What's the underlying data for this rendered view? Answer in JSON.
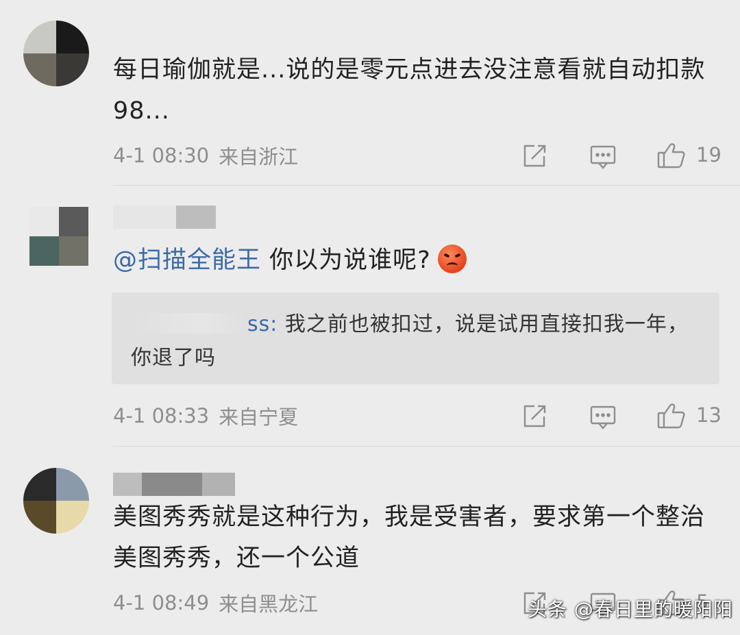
{
  "comments": [
    {
      "text": "每日瑜伽就是...说的是零元点进去没注意看就自动扣款98...",
      "time": "4-1 08:30",
      "location": "来自浙江",
      "likes": "19"
    },
    {
      "mention": "@扫描全能王",
      "text": " 你以为说谁呢?",
      "emoji_icon": "angry-face-icon",
      "quote": {
        "name_visible": "ss:",
        "text": " 我之前也被扣过，说是试用直接扣我一年，你退了吗"
      },
      "time": "4-1 08:33",
      "location": "来自宁夏",
      "likes": "13"
    },
    {
      "text": "美图秀秀就是这种行为，我是受害者，要求第一个整治美图秀秀，还一个公道",
      "time": "4-1 08:49",
      "location": "来自黑龙江",
      "likes": "5"
    }
  ],
  "watermark": "头条 @春日里的暖阳阳",
  "colors": {
    "background": "#ececec",
    "text": "#222222",
    "meta": "#8e8e8e",
    "link": "#3b6aa8",
    "quote_bg": "#e0e0e0"
  }
}
